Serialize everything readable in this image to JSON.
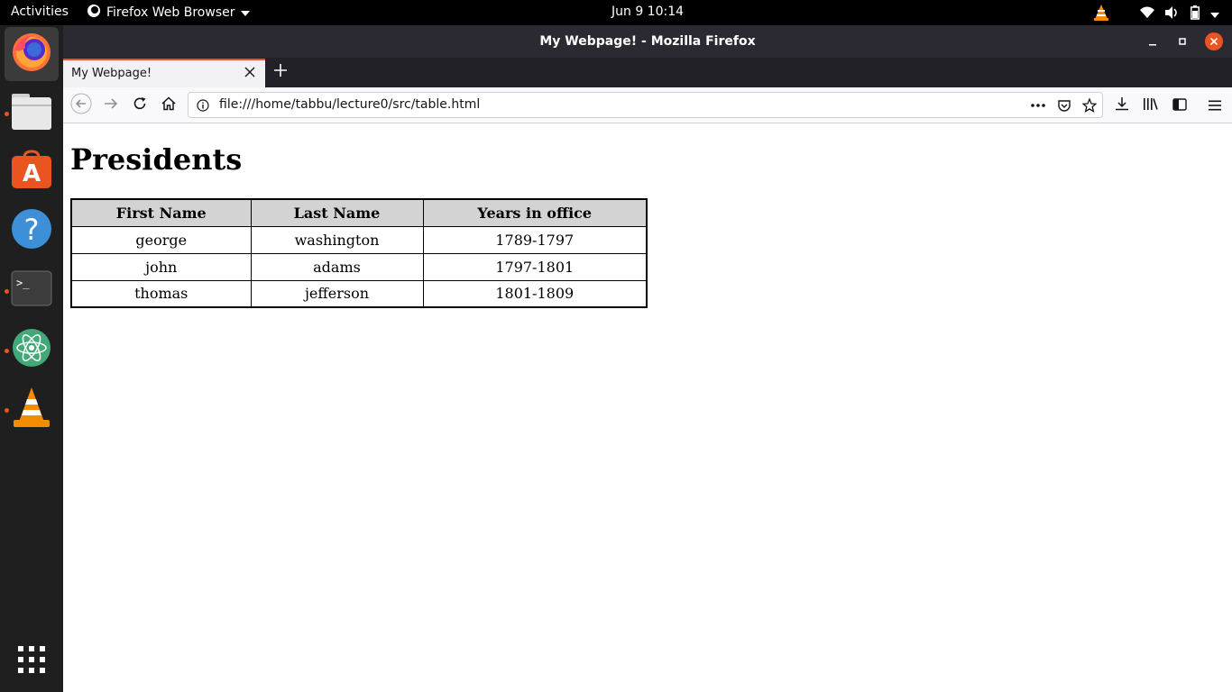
{
  "topbar": {
    "activities": "Activities",
    "app_name": "Firefox Web Browser",
    "clock": "Jun 9  10:14"
  },
  "dock": {
    "apps": [
      "firefox-icon",
      "files-icon",
      "software-center-icon",
      "help-icon",
      "terminal-icon",
      "atom-icon",
      "vlc-icon"
    ],
    "show_apps": "app-grid-icon"
  },
  "window": {
    "title": "My Webpage! - Mozilla Firefox"
  },
  "tabs": [
    {
      "label": "My Webpage!"
    }
  ],
  "navbar": {
    "url": "file:///home/tabbu/lecture0/src/table.html"
  },
  "page": {
    "heading": "Presidents",
    "table": {
      "headers": [
        "First Name",
        "Last Name",
        "Years in office"
      ],
      "rows": [
        [
          "george",
          "washington",
          "1789-1797"
        ],
        [
          "john",
          "adams",
          "1797-1801"
        ],
        [
          "thomas",
          "jefferson",
          "1801-1809"
        ]
      ]
    }
  },
  "colors": {
    "accent": "#e95420",
    "titlebar": "#2b2a33",
    "table_header_bg": "#d3d3d3"
  }
}
